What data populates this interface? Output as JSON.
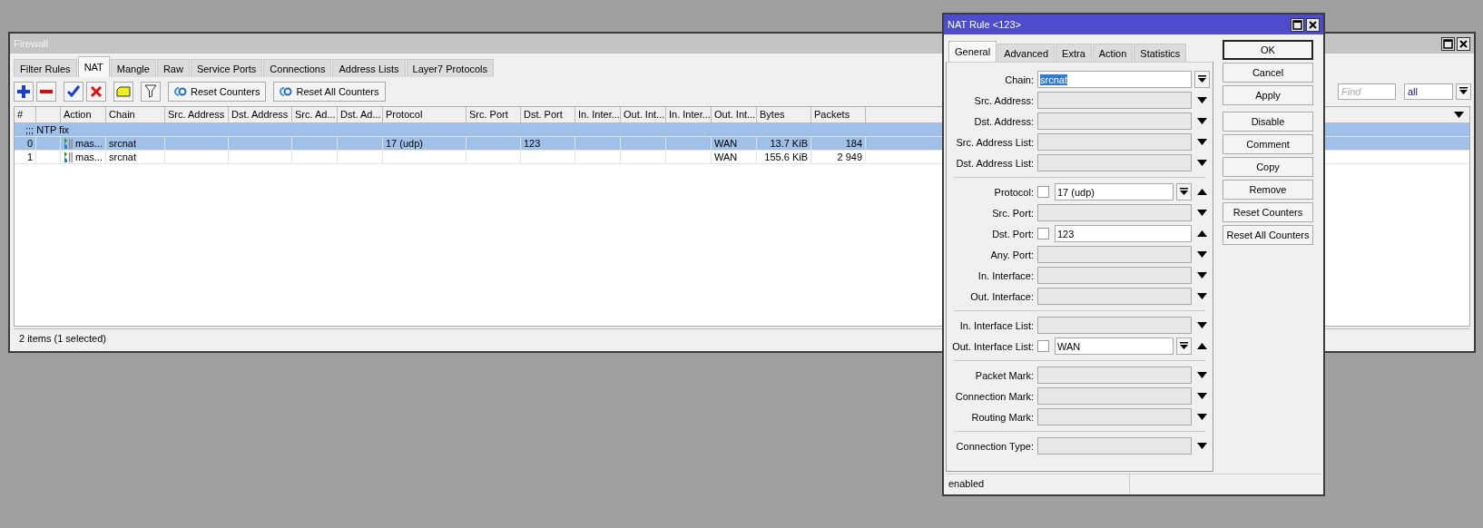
{
  "firewall": {
    "title": "Firewall",
    "tabs": [
      {
        "label": "Filter Rules",
        "selected": false
      },
      {
        "label": "NAT",
        "selected": true
      },
      {
        "label": "Mangle",
        "selected": false
      },
      {
        "label": "Raw",
        "selected": false
      },
      {
        "label": "Service Ports",
        "selected": false
      },
      {
        "label": "Connections",
        "selected": false
      },
      {
        "label": "Address Lists",
        "selected": false
      },
      {
        "label": "Layer7 Protocols",
        "selected": false
      }
    ],
    "toolbar": {
      "buttons": [
        "Reset Counters",
        "Reset All Counters"
      ],
      "find": {
        "placeholder": "Find"
      },
      "filter": {
        "value": "all"
      }
    },
    "table": {
      "columns": [
        "#",
        "Action",
        "Chain",
        "Src. Address",
        "Dst. Address",
        "Src. Ad...",
        "Dst. Ad...",
        "Protocol",
        "Src. Port",
        "Dst. Port",
        "In. Inter...",
        "Out. Int...",
        "In. Inter...",
        "Out. Int...",
        "Bytes",
        "Packets"
      ],
      "rows": [
        {
          "kind": "comment",
          "selected": true,
          "text": ";;; NTP fix"
        },
        {
          "kind": "rule",
          "selected": true,
          "cells": {
            "number": "0",
            "action": "mas...",
            "chain": "srcnat",
            "protocol": "17 (udp)",
            "dst_port": "123",
            "out_interface_list": "WAN",
            "bytes": "13.7 KiB",
            "packets": "184"
          }
        },
        {
          "kind": "rule",
          "selected": false,
          "cells": {
            "number": "1",
            "action": "mas...",
            "chain": "srcnat",
            "out_interface_list": "WAN",
            "bytes": "155.6 KiB",
            "packets": "2 949"
          }
        }
      ]
    },
    "status_bar": "2 items (1 selected)"
  },
  "dialog": {
    "title": "NAT Rule <123>",
    "tabs": [
      {
        "label": "General",
        "selected": true
      },
      {
        "label": "Advanced",
        "selected": false
      },
      {
        "label": "Extra",
        "selected": false
      },
      {
        "label": "Action",
        "selected": false
      },
      {
        "label": "Statistics",
        "selected": false
      }
    ],
    "field_groups": [
      [
        {
          "label": "Chain:",
          "kind": "select",
          "value": "srcnat",
          "text_selected": true
        },
        {
          "label": "Src. Address:",
          "kind": "plain"
        },
        {
          "label": "Dst. Address:",
          "kind": "plain"
        },
        {
          "label": "Src. Address List:",
          "kind": "plain"
        },
        {
          "label": "Dst. Address List:",
          "kind": "plain"
        }
      ],
      [
        {
          "label": "Protocol:",
          "kind": "negatable_select",
          "checked": false,
          "value": "17 (udp)"
        },
        {
          "label": "Src. Port:",
          "kind": "plain"
        },
        {
          "label": "Dst. Port:",
          "kind": "negatable",
          "checked": false,
          "value": "123"
        },
        {
          "label": "Any. Port:",
          "kind": "plain"
        },
        {
          "label": "In. Interface:",
          "kind": "plain"
        },
        {
          "label": "Out. Interface:",
          "kind": "plain"
        }
      ],
      [
        {
          "label": "In. Interface List:",
          "kind": "plain"
        },
        {
          "label": "Out. Interface List:",
          "kind": "negatable_select",
          "checked": false,
          "value": "WAN"
        }
      ],
      [
        {
          "label": "Packet Mark:",
          "kind": "plain"
        },
        {
          "label": "Connection Mark:",
          "kind": "plain"
        },
        {
          "label": "Routing Mark:",
          "kind": "plain"
        }
      ],
      [
        {
          "label": "Connection Type:",
          "kind": "plain"
        }
      ]
    ],
    "button_groups": [
      [
        {
          "label": "OK",
          "default": true
        },
        {
          "label": "Cancel",
          "default": false
        },
        {
          "label": "Apply",
          "default": false
        }
      ],
      [
        {
          "label": "Disable",
          "default": false
        },
        {
          "label": "Comment",
          "default": false
        },
        {
          "label": "Copy",
          "default": false
        },
        {
          "label": "Remove",
          "default": false
        },
        {
          "label": "Reset Counters",
          "default": false
        },
        {
          "label": "Reset All Counters",
          "default": false
        }
      ]
    ],
    "status": "enabled"
  }
}
